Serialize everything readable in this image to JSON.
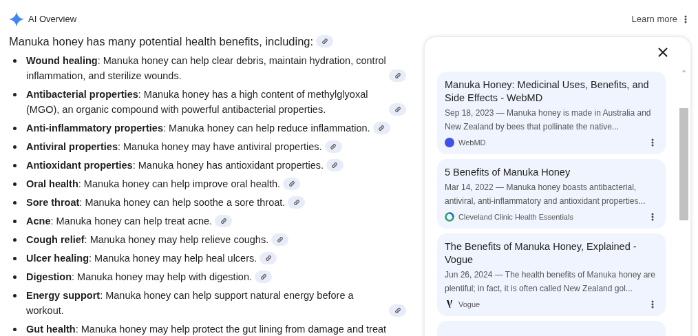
{
  "header": {
    "title": "AI Overview",
    "learn_more": "Learn more"
  },
  "intro": "Manuka honey has many potential health benefits, including:",
  "benefits": [
    {
      "term": "Wound healing",
      "text": ": Manuka honey can help clear debris, maintain hydration, control inflammation, and sterilize wounds.",
      "link": true
    },
    {
      "term": "Antibacterial properties",
      "text": ": Manuka honey has a high content of methylglyoxal (MGO), an organic compound with powerful antibacterial properties.",
      "link": true
    },
    {
      "term": "Anti-inflammatory properties",
      "text": ": Manuka honey can help reduce inflammation.",
      "link": true
    },
    {
      "term": "Antiviral properties",
      "text": ": Manuka honey may have antiviral properties.",
      "link": true
    },
    {
      "term": "Antioxidant properties",
      "text": ": Manuka honey has antioxidant properties.",
      "link": true
    },
    {
      "term": "Oral health",
      "text": ": Manuka honey can help improve oral health.",
      "link": true
    },
    {
      "term": "Sore throat",
      "text": ": Manuka honey can help soothe a sore throat.",
      "link": true
    },
    {
      "term": "Acne",
      "text": ": Manuka honey can help treat acne.",
      "link": true
    },
    {
      "term": "Cough relief",
      "text": ": Manuka honey may help relieve coughs.",
      "link": true
    },
    {
      "term": "Ulcer healing",
      "text": ": Manuka honey may help heal ulcers.",
      "link": true
    },
    {
      "term": "Digestion",
      "text": ": Manuka honey may help with digestion.",
      "link": true
    },
    {
      "term": "Energy support",
      "text": ": Manuka honey can help support natural energy before a workout.",
      "link": true
    },
    {
      "term": "Gut health",
      "text": ": Manuka honey may help protect the gut lining from damage and treat",
      "link": false
    }
  ],
  "sources": [
    {
      "title": "Manuka Honey: Medicinal Uses, Benefits, and Side Effects - WebMD",
      "snippet": "Sep 18, 2023 — Manuka honey is made in Australia and New Zealand by bees that pollinate the native...",
      "site": "WebMD",
      "kind": "circle"
    },
    {
      "title": "5 Benefits of Manuka Honey",
      "snippet": "Mar 14, 2022 — Manuka honey boasts antibacterial, antiviral, anti-inflammatory and antioxidant properties...",
      "site": "Cleveland Clinic Health Essentials",
      "kind": "ring"
    },
    {
      "title": "The Benefits of Manuka Honey, Explained - Vogue",
      "snippet": "Jun 26, 2024 — The health benefits of Manuka honey are plentiful; in fact, it is often called New Zealand gol...",
      "site": "Vogue",
      "kind": "slash"
    }
  ]
}
